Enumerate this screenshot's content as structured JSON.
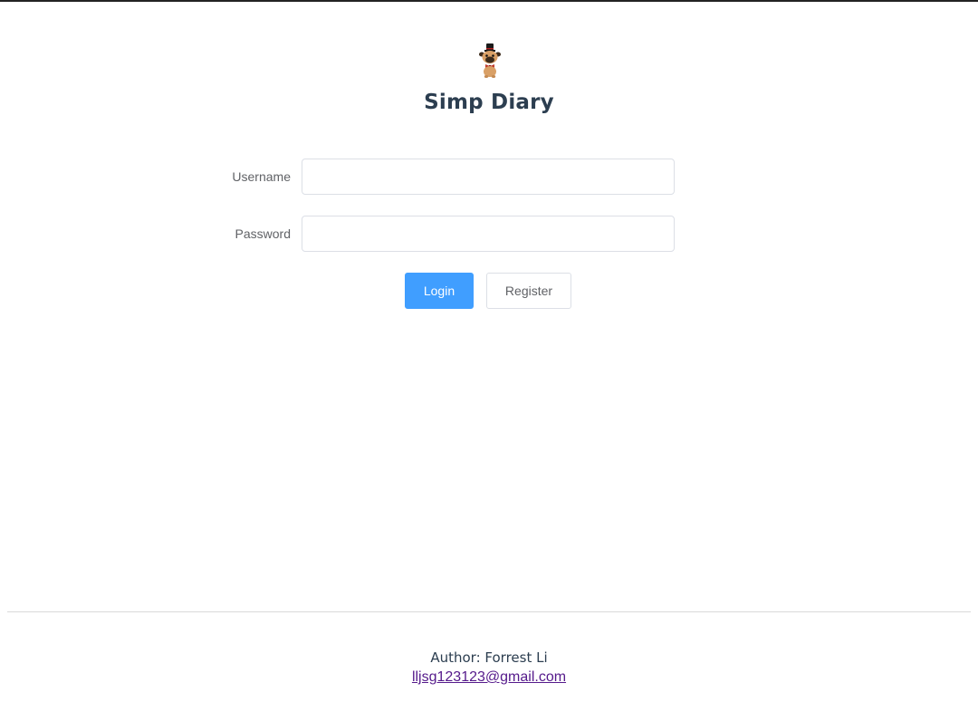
{
  "app": {
    "title": "Simp Diary",
    "logo_icon": "pug-top-hat-icon"
  },
  "form": {
    "username_label": "Username",
    "username_value": "",
    "password_label": "Password",
    "password_value": ""
  },
  "buttons": {
    "login_label": "Login",
    "register_label": "Register"
  },
  "footer": {
    "author": "Author: Forrest Li",
    "email": "lljsg123123@gmail.com"
  },
  "colors": {
    "primary": "#409eff",
    "title": "#2c3e50",
    "link_visited": "#551a8b"
  }
}
